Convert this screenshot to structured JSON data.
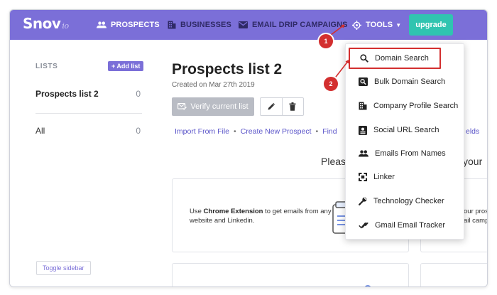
{
  "header": {
    "logo": "Snov",
    "logo_sub": "io",
    "nav": {
      "prospects": "PROSPECTS",
      "businesses": "BUSINESSES",
      "campaigns": "EMAIL DRIP CAMPAIGNS",
      "tools": "TOOLS"
    },
    "upgrade": "upgrade"
  },
  "sidebar": {
    "heading": "LISTS",
    "add_list": "+ Add list",
    "items": [
      {
        "name": "Prospects list 2",
        "count": "0"
      },
      {
        "name": "All",
        "count": "0"
      }
    ],
    "toggle": "Toggle sidebar"
  },
  "main": {
    "title": "Prospects list 2",
    "created": "Created on Mar 27th 2019",
    "verify": "Verify current list",
    "links": {
      "import": "Import From File",
      "sep": "•",
      "create": "Create New Prospect",
      "find": "Find",
      "fields": "elds"
    },
    "please": "Pleas",
    "your": "your",
    "card_ext_pre": "Use ",
    "card_ext_bold": "Chrome Extension",
    "card_ext_post": " to get emails from any website and Linkedin.",
    "card2_line1": "our pros",
    "card2_line2": "ail camp"
  },
  "dropdown": {
    "items": [
      {
        "label": "Domain Search",
        "icon": "search-icon"
      },
      {
        "label": "Bulk Domain Search",
        "icon": "bulk-search-icon"
      },
      {
        "label": "Company Profile Search",
        "icon": "building-icon"
      },
      {
        "label": "Social URL Search",
        "icon": "id-card-icon"
      },
      {
        "label": "Emails From Names",
        "icon": "people-icon"
      },
      {
        "label": "Linker",
        "icon": "linker-icon"
      },
      {
        "label": "Technology Checker",
        "icon": "wrench-icon"
      },
      {
        "label": "Gmail Email Tracker",
        "icon": "double-check-icon"
      }
    ]
  },
  "annotations": {
    "step1": "1",
    "step2": "2"
  },
  "colors": {
    "header": "#7b6fd8",
    "upgrade": "#30c4b0",
    "link": "#5a54c9",
    "annotation": "#d32f2f",
    "verify_disabled": "#b9bcc4"
  }
}
